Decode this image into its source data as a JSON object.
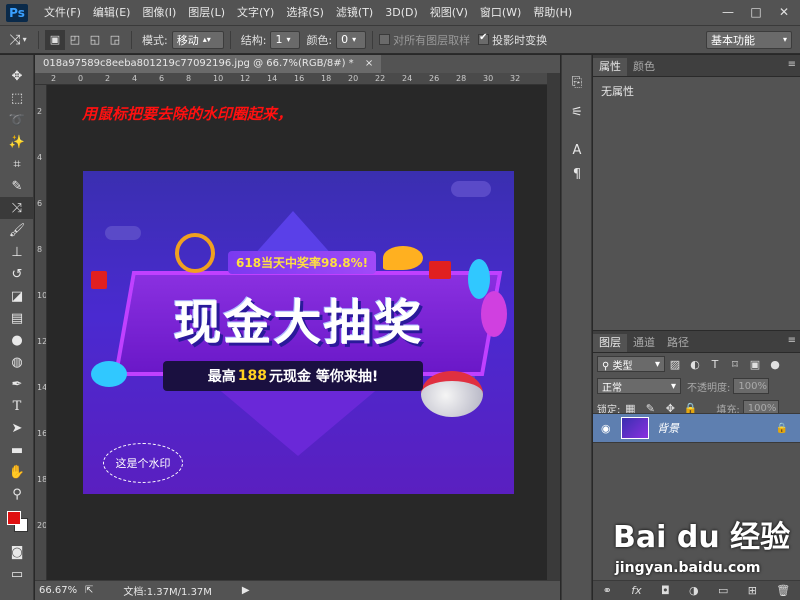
{
  "app": {
    "logo": "Ps",
    "menu": [
      "文件(F)",
      "编辑(E)",
      "图像(I)",
      "图层(L)",
      "文字(Y)",
      "选择(S)",
      "滤镜(T)",
      "3D(D)",
      "视图(V)",
      "窗口(W)",
      "帮助(H)"
    ],
    "window_controls": [
      "—",
      "□",
      "✕"
    ]
  },
  "options": {
    "mode_label": "模式:",
    "mode_value": "移动",
    "structure_label": "结构:",
    "structure_value": "1",
    "color_label": "颜色:",
    "color_value": "0",
    "sample_all_label": "对所有图层取样",
    "sample_all_checked": false,
    "transform_on_drop_label": "投影时变换",
    "transform_on_drop_checked": true,
    "workspace": "基本功能"
  },
  "document": {
    "tab_title": "018a97589c8eeba801219c77092196.jpg @ 66.7%(RGB/8#) *",
    "ruler_top": [
      "2",
      "0",
      "2",
      "4",
      "6",
      "8",
      "10",
      "12",
      "14",
      "16",
      "18",
      "20",
      "22",
      "24",
      "26",
      "28",
      "30",
      "32"
    ],
    "ruler_left": [
      "2",
      "4",
      "6",
      "8",
      "10",
      "12",
      "14",
      "16",
      "18",
      "20"
    ],
    "zoom": "66.67%",
    "doc_size": "文档:1.37M/1.37M"
  },
  "annotation": {
    "instruction": "用鼠标把要去除的水印圈起来，"
  },
  "poster": {
    "rate_tag": "618当天中奖率98.8%!",
    "title": "现金大抽奖",
    "subtitle_prefix": "最高",
    "subtitle_amount": "188",
    "subtitle_suffix": "元现金 等你来抽!",
    "watermark_text": "这是个水印"
  },
  "panels": {
    "properties_tabs": [
      "属性",
      "颜色"
    ],
    "properties_empty": "无属性",
    "layers_tabs": [
      "图层",
      "通道",
      "路径"
    ],
    "filter_kind": "类型",
    "blend_mode": "正常",
    "opacity_label": "不透明度:",
    "opacity_value": "100%",
    "lock_label": "锁定:",
    "fill_label": "填充:",
    "fill_value": "100%",
    "layer_name": "背景"
  },
  "watermark_site": {
    "brand": "Bai du 经验",
    "url": "jingyan.baidu.com"
  },
  "colors": {
    "foreground": "#e01010",
    "background": "#ffffff",
    "layer_selected": "#5e7fb0",
    "instruction": "#ff1010"
  }
}
